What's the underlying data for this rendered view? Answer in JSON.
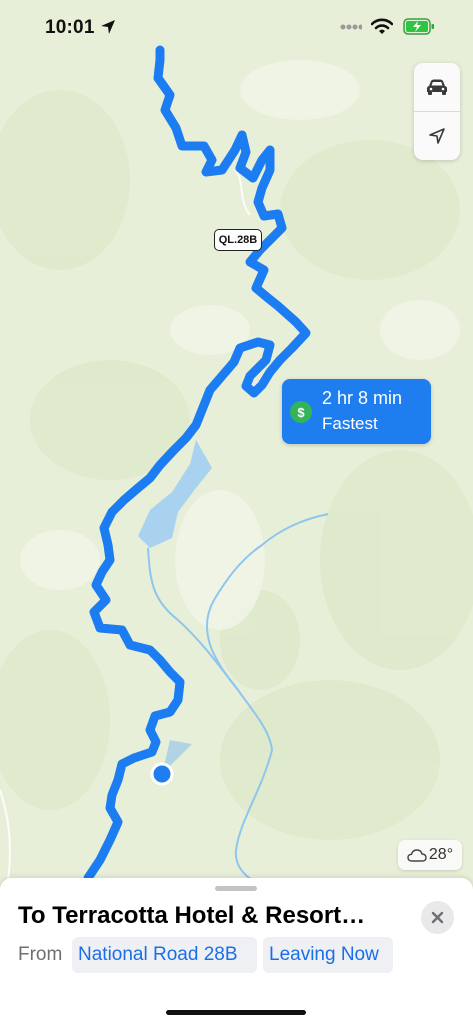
{
  "status_bar": {
    "time": "10:01",
    "location_icon": "location-arrow-icon",
    "wifi_icon": "wifi-icon",
    "battery_icon": "battery-charging-icon"
  },
  "map": {
    "road_shield": "QL.28B",
    "route_callout": {
      "icon": "dollar-icon",
      "icon_glyph": "$",
      "duration": "2 hr 8 min",
      "label": "Fastest"
    },
    "controls": {
      "transport_mode_icon": "car-icon",
      "tracking_icon": "location-arrow-icon"
    },
    "weather": {
      "icon": "cloud-icon",
      "temperature": "28°"
    },
    "colors": {
      "land": "#e8efd9",
      "route": "#1c7cf2",
      "water": "#a8d2f0",
      "callout": "#1e7ef0",
      "toll_badge": "#34b458"
    }
  },
  "directions": {
    "title": "To Terracotta Hotel & Resort…",
    "from_label": "From",
    "origin": "National Road 28B",
    "departure": "Leaving Now",
    "close_icon": "close-icon"
  }
}
